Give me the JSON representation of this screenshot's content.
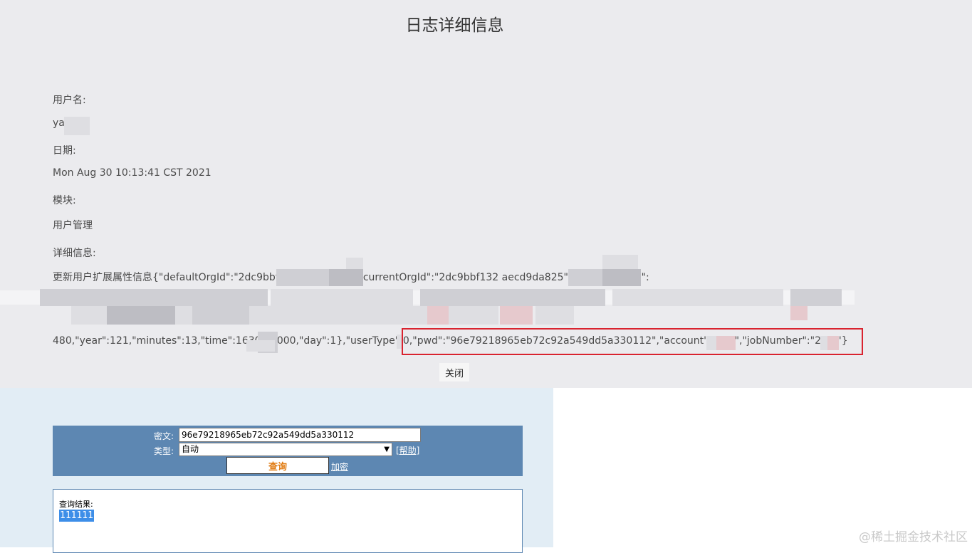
{
  "log_detail": {
    "title": "日志详细信息",
    "username_label": "用户名:",
    "username_value": "ya",
    "date_label": "日期:",
    "date_value": "Mon Aug 30 10:13:41 CST 2021",
    "module_label": "模块:",
    "module_value": "用户管理",
    "detail_label": "详细信息:",
    "detail_line1": "更新用户扩展属性信息{\"defaultOrgId\":\"2dc9bbt                              daecd9da825\",\"currentOrgId\":\"2dc9bbf132                              aecd9da825\",\"userOrgUnits\":",
    "detail_line3_part1": "480,\"year\":121,\"minutes\":13,\"time\":16302          9000,\"day\":1},\"userType\":0,",
    "detail_line3_part2": "\"pwd\":\"96e79218965eb72c92a549dd5a330112\",\"account\":\"tes        \",\"jobNumber\":\"27        8\"}",
    "close_label": "关闭"
  },
  "query_tool": {
    "cipher_label": "密文:",
    "cipher_value": "96e79218965eb72c92a549dd5a330112",
    "type_label": "类型:",
    "type_value": "自动",
    "help_label": "[帮助]",
    "query_label": "查询",
    "encrypt_label": "加密",
    "result_label": "查询结果:",
    "result_value": "111111"
  },
  "watermark": "@稀土掘金技术社区",
  "colors": {
    "panel_bg": "#ebebee",
    "highlight_border": "#d9232f",
    "form_bg": "#5d87b2",
    "query_text": "#e07a10",
    "selection": "#3d8ee8"
  }
}
